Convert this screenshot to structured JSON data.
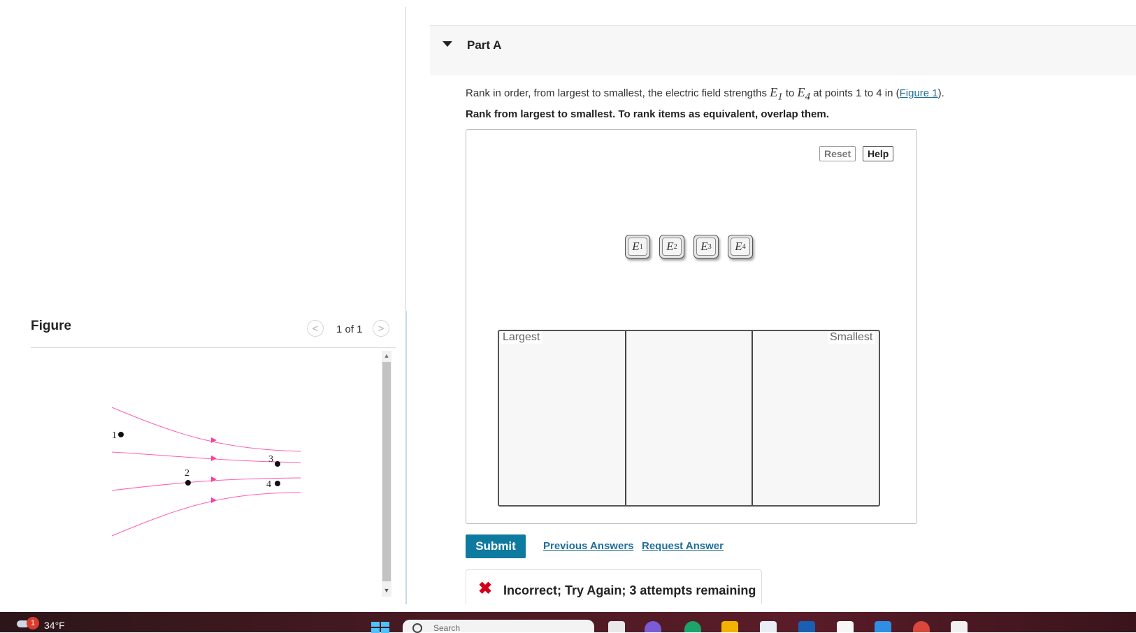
{
  "figure_panel": {
    "title": "Figure",
    "pager": "1 of 1",
    "prev_glyph": "<",
    "next_glyph": ">",
    "points": [
      "1",
      "2",
      "3",
      "4"
    ]
  },
  "part": {
    "title": "Part A",
    "question_before": "Rank in order, from largest to smallest, the electric field strengths ",
    "e1_symbol": "E",
    "e1_sub": "1",
    "question_mid": " to ",
    "e4_symbol": "E",
    "e4_sub": "4",
    "question_after": " at points 1 to 4 in (",
    "figure_link": "Figure 1",
    "question_end": ").",
    "instruction": "Rank from largest to smallest. To rank items as equivalent, overlap them."
  },
  "ranking": {
    "reset_label": "Reset",
    "help_label": "Help",
    "items": [
      {
        "symbol": "E",
        "sub": "1"
      },
      {
        "symbol": "E",
        "sub": "2"
      },
      {
        "symbol": "E",
        "sub": "3"
      },
      {
        "symbol": "E",
        "sub": "4"
      }
    ],
    "largest_label": "Largest",
    "smallest_label": "Smallest"
  },
  "actions": {
    "submit_label": "Submit",
    "previous_answers": "Previous Answers",
    "request_answer": "Request Answer"
  },
  "feedback": {
    "icon": "✖",
    "text": "Incorrect; Try Again; 3 attempts remaining"
  },
  "taskbar": {
    "weather_badge": "1",
    "temperature": "34°F",
    "search_placeholder": "Search"
  },
  "colors": {
    "accent": "#0f7aa0",
    "link": "#1f6f9a",
    "error": "#d0021b",
    "field_lines": "#ff5fb0"
  }
}
